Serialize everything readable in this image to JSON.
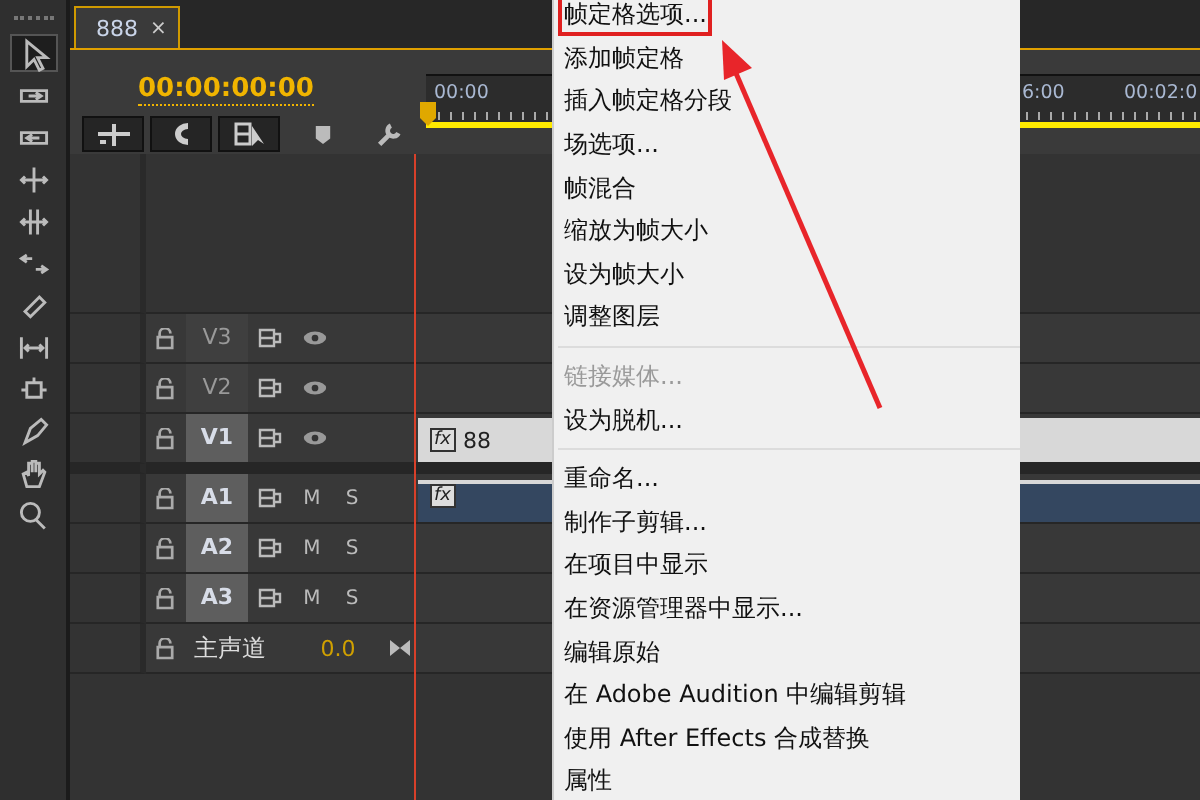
{
  "toolbar": {
    "tools": [
      {
        "kind": "select",
        "selected": true
      },
      {
        "kind": "track-forward",
        "selected": false
      },
      {
        "kind": "track-backward",
        "selected": false
      },
      {
        "kind": "ripple",
        "selected": false
      },
      {
        "kind": "rolling",
        "selected": false
      },
      {
        "kind": "rate",
        "selected": false
      },
      {
        "kind": "razor",
        "selected": false
      },
      {
        "kind": "slip",
        "selected": false
      },
      {
        "kind": "slide",
        "selected": false
      },
      {
        "kind": "pen",
        "selected": false
      },
      {
        "kind": "hand",
        "selected": false
      },
      {
        "kind": "zoom",
        "selected": false
      }
    ]
  },
  "sequence_tab": {
    "title": "888",
    "close": "×"
  },
  "timecode": "00:00:00:00",
  "ruler": {
    "labels": [
      "00:00",
      "6:00",
      "00:02:0"
    ]
  },
  "video_tracks": [
    {
      "name": "V3",
      "targeted": false
    },
    {
      "name": "V2",
      "targeted": false
    },
    {
      "name": "V1",
      "targeted": true,
      "clip": {
        "badge": "fx",
        "label": "88"
      }
    }
  ],
  "audio_tracks": [
    {
      "name": "A1",
      "targeted": true,
      "mute": "M",
      "solo": "S",
      "clip": {
        "badge": "fx"
      }
    },
    {
      "name": "A2",
      "targeted": true,
      "mute": "M",
      "solo": "S"
    },
    {
      "name": "A3",
      "targeted": true,
      "mute": "M",
      "solo": "S"
    }
  ],
  "master_track": {
    "name": "主声道",
    "volume": "0.0"
  },
  "context_menu": {
    "items": [
      {
        "kind": "item",
        "label": "帧定格选项...",
        "disabled": false,
        "annotated": true
      },
      {
        "kind": "item",
        "label": "添加帧定格",
        "disabled": false,
        "annotated": false
      },
      {
        "kind": "item",
        "label": "插入帧定格分段",
        "disabled": false,
        "annotated": false
      },
      {
        "kind": "item",
        "label": "场选项...",
        "disabled": false,
        "annotated": false
      },
      {
        "kind": "item",
        "label": "帧混合",
        "disabled": false,
        "annotated": false
      },
      {
        "kind": "item",
        "label": "缩放为帧大小",
        "disabled": false,
        "annotated": false
      },
      {
        "kind": "item",
        "label": "设为帧大小",
        "disabled": false,
        "annotated": false
      },
      {
        "kind": "item",
        "label": "调整图层",
        "disabled": false,
        "annotated": false
      },
      {
        "kind": "separator"
      },
      {
        "kind": "item",
        "label": "链接媒体...",
        "disabled": true,
        "annotated": false
      },
      {
        "kind": "item",
        "label": "设为脱机...",
        "disabled": false,
        "annotated": false
      },
      {
        "kind": "separator"
      },
      {
        "kind": "item",
        "label": "重命名...",
        "disabled": false,
        "annotated": false
      },
      {
        "kind": "item",
        "label": "制作子剪辑...",
        "disabled": false,
        "annotated": false
      },
      {
        "kind": "item",
        "label": "在项目中显示",
        "disabled": false,
        "annotated": false
      },
      {
        "kind": "item",
        "label": "在资源管理器中显示...",
        "disabled": false,
        "annotated": false
      },
      {
        "kind": "item",
        "label": "编辑原始",
        "disabled": false,
        "annotated": false
      },
      {
        "kind": "item",
        "label": "在 Adobe Audition 中编辑剪辑",
        "disabled": false,
        "annotated": false
      },
      {
        "kind": "item",
        "label": "使用 After Effects 合成替换",
        "disabled": false,
        "annotated": false
      },
      {
        "kind": "item",
        "label": "属性",
        "disabled": false,
        "annotated": false
      }
    ]
  }
}
